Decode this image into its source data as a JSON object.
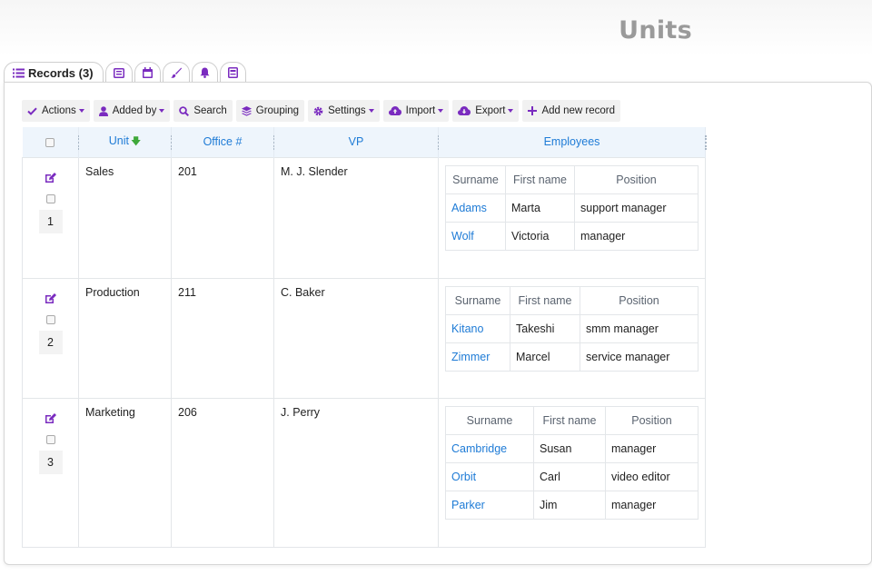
{
  "page": {
    "title": "Units"
  },
  "tabs": [
    {
      "label": "Records (3)",
      "icon": "list-icon"
    },
    {
      "icon": "table-icon"
    },
    {
      "icon": "calendar-icon"
    },
    {
      "icon": "brush-icon"
    },
    {
      "icon": "bell-icon"
    },
    {
      "icon": "form-icon"
    }
  ],
  "toolbar": {
    "actions": "Actions",
    "added_by": "Added by",
    "search": "Search",
    "grouping": "Grouping",
    "settings": "Settings",
    "import": "Import",
    "export": "Export",
    "add_new": "Add new record"
  },
  "colors": {
    "accent": "#7a2bbf",
    "link": "#1e7bd6",
    "sort": "#3ea83a",
    "header_bg": "#eef5fc"
  },
  "table": {
    "columns": {
      "unit": "Unit",
      "office": "Office #",
      "vp": "VP",
      "employees": "Employees"
    },
    "subcolumns": {
      "surname": "Surname",
      "first_name": "First name",
      "position": "Position"
    },
    "rows": [
      {
        "num": "1",
        "unit": "Sales",
        "office": "201",
        "vp": "M. J. Slender",
        "employees": [
          {
            "surname": "Adams",
            "first_name": "Marta",
            "position": "support manager"
          },
          {
            "surname": "Wolf",
            "first_name": "Victoria",
            "position": "manager"
          }
        ]
      },
      {
        "num": "2",
        "unit": "Production",
        "office": "211",
        "vp": "C. Baker",
        "employees": [
          {
            "surname": "Kitano",
            "first_name": "Takeshi",
            "position": "smm manager"
          },
          {
            "surname": "Zimmer",
            "first_name": "Marcel",
            "position": "service manager"
          }
        ]
      },
      {
        "num": "3",
        "unit": "Marketing",
        "office": "206",
        "vp": "J. Perry",
        "employees": [
          {
            "surname": "Cambridge",
            "first_name": "Susan",
            "position": "manager"
          },
          {
            "surname": "Orbit",
            "first_name": "Carl",
            "position": "video editor"
          },
          {
            "surname": "Parker",
            "first_name": "Jim",
            "position": "manager"
          }
        ]
      }
    ]
  }
}
